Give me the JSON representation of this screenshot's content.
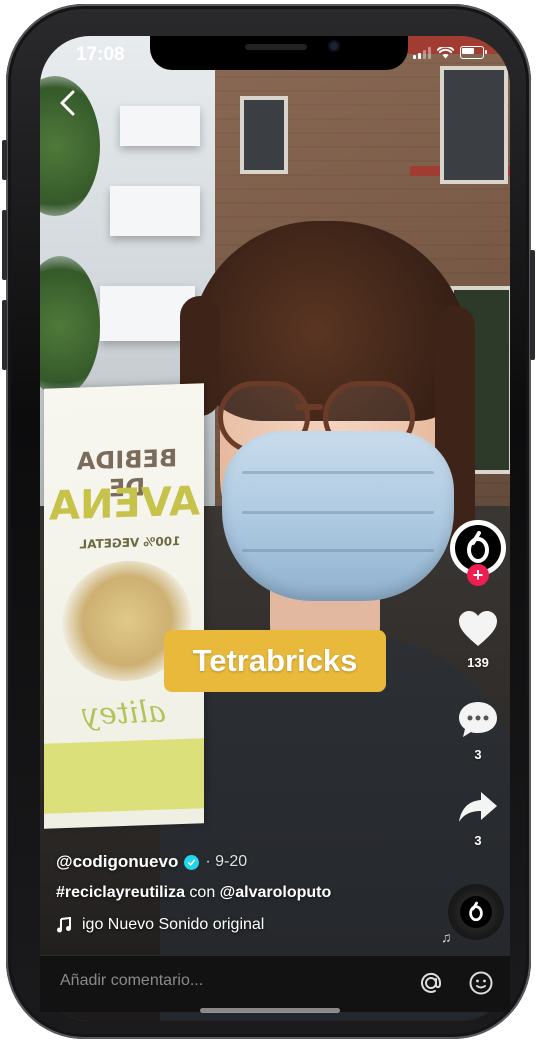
{
  "status_bar": {
    "time": "17:08"
  },
  "video": {
    "overlay_text": "Tetrabricks",
    "carton": {
      "title": "BEBIDA DE",
      "big": "AVENA",
      "sub": "100% VEGETAL",
      "brand": "alitey"
    }
  },
  "actions": {
    "likes": "139",
    "comments": "3",
    "shares": "3"
  },
  "caption": {
    "username": "@codigonuevo",
    "date": "· 9-20",
    "hashtag": "#reciclayreutiliza",
    "with_word": " con ",
    "mention": "@alvaroloputo",
    "sound": "igo Nuevo Sonido original"
  },
  "comment_bar": {
    "placeholder": "Añadir comentario..."
  },
  "colors": {
    "accent_red": "#ee1d52",
    "label_yellow": "#e8b93a",
    "verified_cyan": "#20d5ec"
  },
  "icons": [
    "back-arrow-icon",
    "heart-icon",
    "comment-icon",
    "share-arrow-icon",
    "music-note-icon",
    "at-sign-icon",
    "emoji-icon"
  ]
}
